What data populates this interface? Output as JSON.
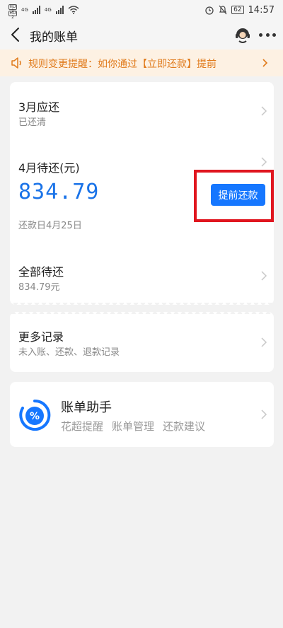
{
  "status_bar": {
    "sim1": "HD 1",
    "sim2": "HD 2",
    "net1": "4G",
    "net2": "4G",
    "battery": "62",
    "time": "14:57"
  },
  "nav": {
    "title": "我的账单"
  },
  "notice": {
    "text": "规则变更提醒：如你通过【立即还款】提前"
  },
  "bill": {
    "march_title": "3月应还",
    "march_status": "已还清",
    "april_title": "4月待还(元)",
    "april_amount": "834.79",
    "april_due": "还款日4月25日",
    "repay_button": "提前还款",
    "total_title": "全部待还",
    "total_amount": "834.79元"
  },
  "more_records": {
    "title": "更多记录",
    "subtitle": "未入账、还款、退款记录"
  },
  "assistant": {
    "title": "账单助手",
    "tags": [
      "花超提醒",
      "账单管理",
      "还款建议"
    ]
  },
  "colors": {
    "accent": "#1677ff",
    "amount": "#1a73e8",
    "notice_bg": "#fdf1e3",
    "notice_text": "#e07a1b",
    "highlight": "#e0161f"
  }
}
